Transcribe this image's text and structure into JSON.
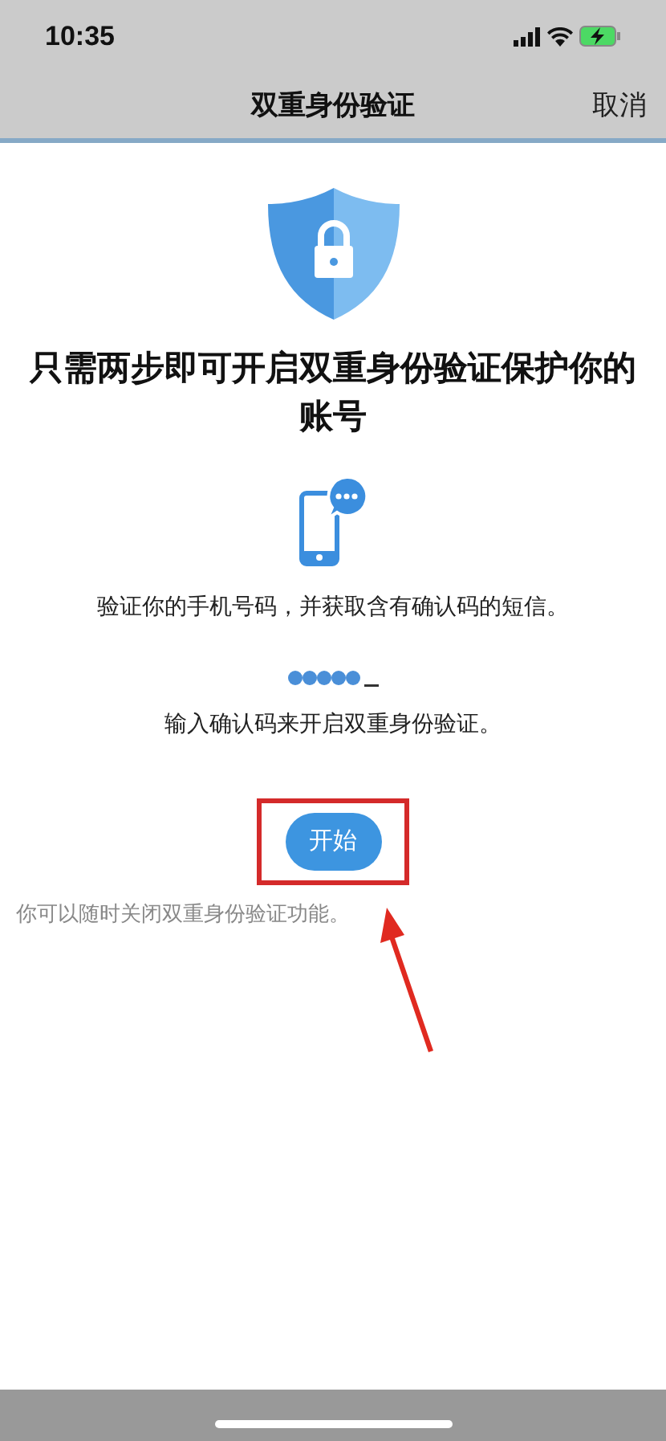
{
  "status_bar": {
    "time": "10:35"
  },
  "nav_bar": {
    "title": "双重身份验证",
    "cancel": "取消"
  },
  "heading": "只需两步即可开启双重身份验证保护你的账号",
  "steps": [
    {
      "kind": "phone",
      "text": "验证你的手机号码，并获取含有确认码的短信。"
    },
    {
      "kind": "code",
      "text": "输入确认码来开启双重身份验证。"
    }
  ],
  "start_button": "开始",
  "footnote": "你可以随时关闭双重身份验证功能。"
}
